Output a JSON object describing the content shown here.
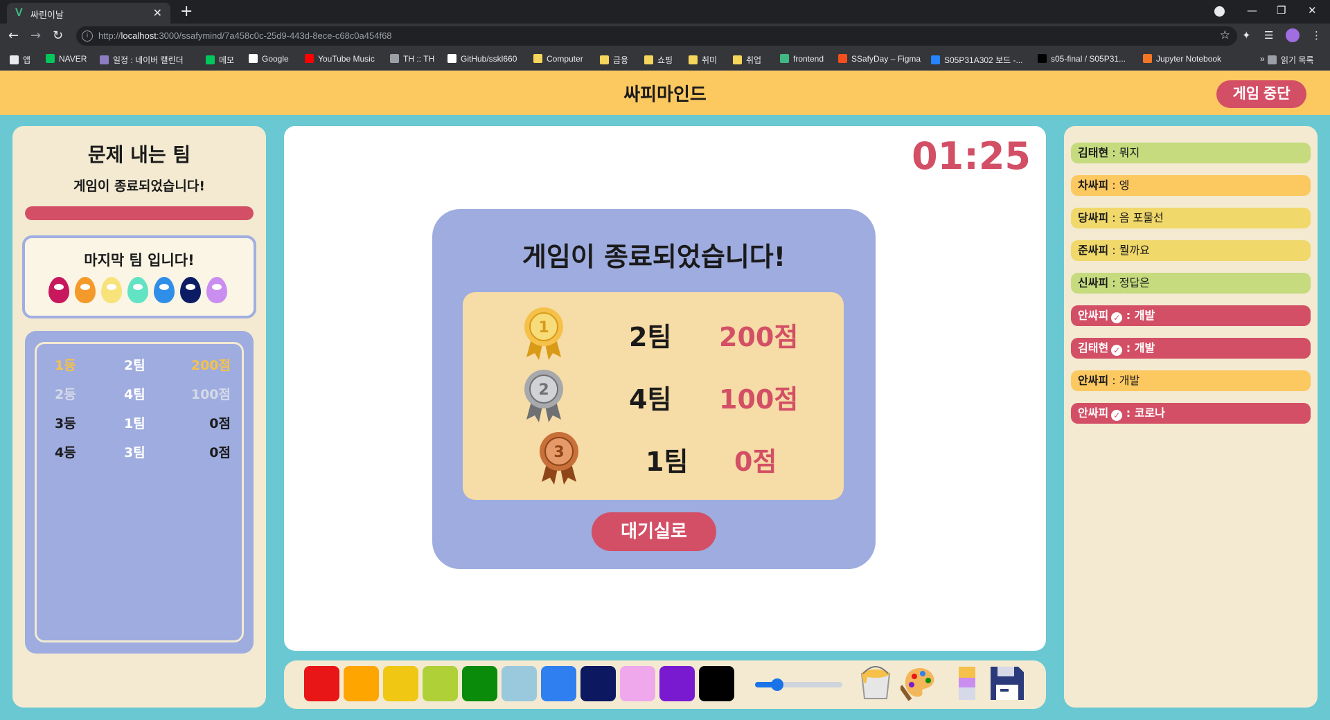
{
  "browser": {
    "tab_title": "싸린이날",
    "tab_favicon": "V",
    "url_prefix": "http://",
    "url_host": "localhost",
    "url_path": ":3000/ssafymind/7a458c0c-25d9-443d-8ece-c68c0a454f68",
    "bookmarks": [
      {
        "label": "앱",
        "color": "#e8eaed"
      },
      {
        "label": "NAVER",
        "color": "#03c75a"
      },
      {
        "label": "일정 : 네이버 캘린더",
        "color": "#8e7cc3"
      },
      {
        "label": "메모",
        "color": "#03c75a"
      },
      {
        "label": "Google",
        "color": "#ffffff"
      },
      {
        "label": "YouTube Music",
        "color": "#ff0000"
      },
      {
        "label": "TH :: TH",
        "color": "#9aa0a6"
      },
      {
        "label": "GitHub/sskl660",
        "color": "#ffffff"
      },
      {
        "label": "Computer",
        "color": "#f6d55c"
      },
      {
        "label": "금융",
        "color": "#f6d55c"
      },
      {
        "label": "쇼핑",
        "color": "#f6d55c"
      },
      {
        "label": "취미",
        "color": "#f6d55c"
      },
      {
        "label": "취업",
        "color": "#f6d55c"
      },
      {
        "label": "frontend",
        "color": "#41b883"
      },
      {
        "label": "SSafyDay – Figma",
        "color": "#f24e1e"
      },
      {
        "label": "S05P31A302 보드 -...",
        "color": "#2684ff"
      },
      {
        "label": "s05-final / S05P31...",
        "color": "#000000"
      },
      {
        "label": "Jupyter Notebook",
        "color": "#f37626"
      },
      {
        "label": "»",
        "color": "#35363a"
      },
      {
        "label": "읽기 목록",
        "color": "#9aa0a6"
      }
    ]
  },
  "header": {
    "title": "싸피마인드",
    "stop_button": "게임 중단"
  },
  "left_panel": {
    "title": "문제 내는 팀",
    "subtitle": "게임이 종료되었습니다!",
    "progress_fraction": 1.0,
    "team_message": "마지막 팀 입니다!",
    "egg_colors": [
      "#c8175d",
      "#f49a2b",
      "#f8e27a",
      "#62e3c4",
      "#2f8ee8",
      "#0c1c64",
      "#c98ef0"
    ],
    "ranking": [
      {
        "rank": "1등",
        "team": "2팀",
        "score": "200점",
        "rank_color": "#f5c14a",
        "team_color": "#ffffff",
        "score_color": "#f5c14a"
      },
      {
        "rank": "2등",
        "team": "4팀",
        "score": "100점",
        "rank_color": "#d6d9e8",
        "team_color": "#ffffff",
        "score_color": "#d6d9e8"
      },
      {
        "rank": "3등",
        "team": "1팀",
        "score": "0점",
        "rank_color": "#1a1a1a",
        "team_color": "#ffffff",
        "score_color": "#1a1a1a"
      },
      {
        "rank": "4등",
        "team": "3팀",
        "score": "0점",
        "rank_color": "#1a1a1a",
        "team_color": "#ffffff",
        "score_color": "#1a1a1a"
      }
    ]
  },
  "board": {
    "timer": "01:25",
    "result_title": "게임이 종료되었습니다!",
    "podium": [
      {
        "medal": "gold-medal-icon",
        "medal_number": "1",
        "team": "2팀",
        "score": "200점"
      },
      {
        "medal": "silver-medal-icon",
        "medal_number": "2",
        "team": "4팀",
        "score": "100점"
      },
      {
        "medal": "bronze-medal-icon",
        "medal_number": "3",
        "team": "1팀",
        "score": "0점"
      }
    ],
    "lobby_button": "대기실로"
  },
  "palette": {
    "colors": [
      "#e81616",
      "#ffa500",
      "#f0c712",
      "#b0d038",
      "#0a8c0a",
      "#9ac8dc",
      "#2f7ff0",
      "#0c1860",
      "#f0a8ec",
      "#7a1ad0",
      "#000000"
    ],
    "brush_size_fraction": 0.25,
    "tools": [
      "paint-bucket-icon",
      "palette-icon",
      "eraser-icon",
      "save-icon"
    ]
  },
  "chat": [
    {
      "name": "김태현",
      "message": "뭐지",
      "color": "#c5db7e",
      "checked": false,
      "red": false
    },
    {
      "name": "차싸피",
      "message": "엥",
      "color": "#fcc860",
      "checked": false,
      "red": false
    },
    {
      "name": "당싸피",
      "message": "음 포물선",
      "color": "#f0d86a",
      "checked": false,
      "red": false
    },
    {
      "name": "준싸피",
      "message": "뭘까요",
      "color": "#f0d86a",
      "checked": false,
      "red": false
    },
    {
      "name": "신싸피",
      "message": "정답은",
      "color": "#c5db7e",
      "checked": false,
      "red": false
    },
    {
      "name": "안싸피",
      "message": "개발",
      "color": "#d34f66",
      "checked": true,
      "red": true
    },
    {
      "name": "김태현",
      "message": "개발",
      "color": "#d34f66",
      "checked": true,
      "red": true
    },
    {
      "name": "안싸피",
      "message": "개발",
      "color": "#fcc860",
      "checked": false,
      "red": false
    },
    {
      "name": "안싸피",
      "message": "코로나",
      "color": "#d34f66",
      "checked": true,
      "red": true
    }
  ]
}
